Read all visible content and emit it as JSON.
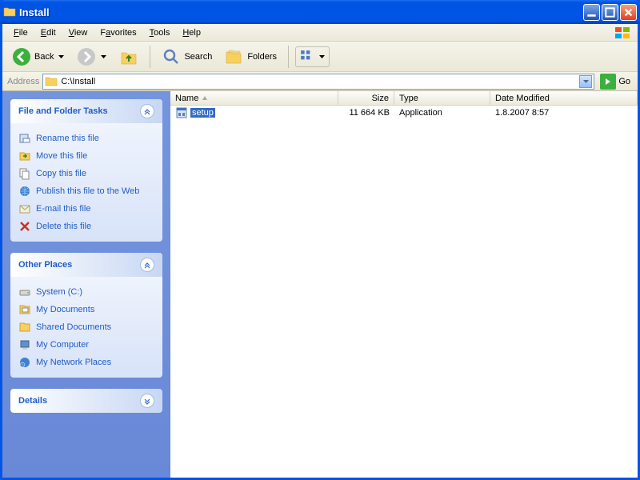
{
  "window": {
    "title": "Install"
  },
  "menu": {
    "file": "File",
    "edit": "Edit",
    "view": "View",
    "favorites": "Favorites",
    "tools": "Tools",
    "help": "Help",
    "file_u": "F",
    "edit_u": "E",
    "view_u": "V",
    "favorites_u": "a",
    "tools_u": "T",
    "help_u": "H"
  },
  "toolbar": {
    "back": "Back",
    "search": "Search",
    "folders": "Folders"
  },
  "addressbar": {
    "label": "Address",
    "path": "C:\\Install",
    "go": "Go"
  },
  "sidebar": {
    "tasks": {
      "title": "File and Folder Tasks",
      "items": [
        {
          "label": "Rename this file",
          "icon": "rename"
        },
        {
          "label": "Move this file",
          "icon": "move"
        },
        {
          "label": "Copy this file",
          "icon": "copy"
        },
        {
          "label": "Publish this file to the Web",
          "icon": "publish"
        },
        {
          "label": "E-mail this file",
          "icon": "email"
        },
        {
          "label": "Delete this file",
          "icon": "delete"
        }
      ]
    },
    "places": {
      "title": "Other Places",
      "items": [
        {
          "label": "System (C:)",
          "icon": "drive"
        },
        {
          "label": "My Documents",
          "icon": "mydocs"
        },
        {
          "label": "Shared Documents",
          "icon": "shareddocs"
        },
        {
          "label": "My Computer",
          "icon": "computer"
        },
        {
          "label": "My Network Places",
          "icon": "network"
        }
      ]
    },
    "details": {
      "title": "Details"
    }
  },
  "columns": {
    "name": "Name",
    "size": "Size",
    "type": "Type",
    "date": "Date Modified"
  },
  "files": [
    {
      "name": "setup",
      "size": "11 664 KB",
      "type": "Application",
      "date": "1.8.2007 8:57",
      "selected": true
    }
  ]
}
